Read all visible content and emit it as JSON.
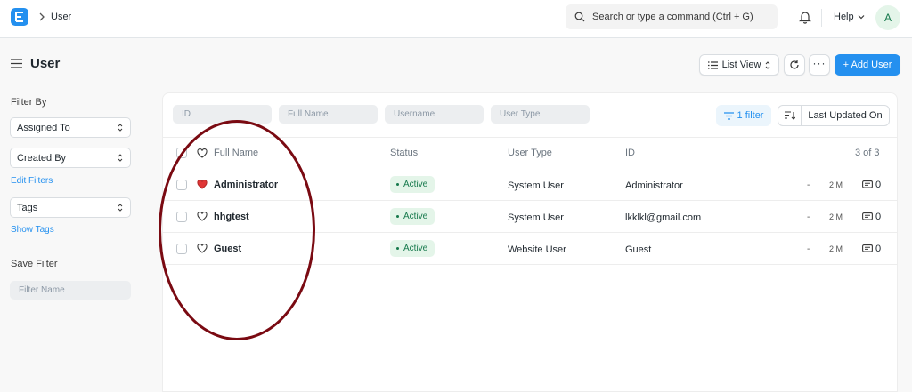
{
  "navbar": {
    "breadcrumb": "User",
    "search_placeholder": "Search or type a command (Ctrl + G)",
    "help_label": "Help",
    "avatar_initial": "A"
  },
  "page": {
    "title": "User",
    "list_view_label": "List View",
    "add_button_label": "+ Add User"
  },
  "sidebar": {
    "filter_by_label": "Filter By",
    "assigned_to": "Assigned To",
    "created_by": "Created By",
    "edit_filters": "Edit Filters",
    "tags": "Tags",
    "show_tags": "Show Tags",
    "save_filter_label": "Save Filter",
    "filter_name_placeholder": "Filter Name"
  },
  "filters": {
    "id_placeholder": "ID",
    "full_name_placeholder": "Full Name",
    "username_placeholder": "Username",
    "user_type_placeholder": "User Type",
    "filter_count_label": "1 filter",
    "sort_label": "Last Updated On"
  },
  "table": {
    "columns": {
      "full_name": "Full Name",
      "status": "Status",
      "user_type": "User Type",
      "id": "ID",
      "count": "3 of 3"
    },
    "rows": [
      {
        "name": "Administrator",
        "liked": true,
        "status": "Active",
        "user_type": "System User",
        "id": "Administrator",
        "dash": "-",
        "modified": "2 M",
        "comments": "0"
      },
      {
        "name": "hhgtest",
        "liked": false,
        "status": "Active",
        "user_type": "System User",
        "id": "lkklkl@gmail.com",
        "dash": "-",
        "modified": "2 M",
        "comments": "0"
      },
      {
        "name": "Guest",
        "liked": false,
        "status": "Active",
        "user_type": "Website User",
        "id": "Guest",
        "dash": "-",
        "modified": "2 M",
        "comments": "0"
      }
    ]
  },
  "colors": {
    "accent": "#2490ef",
    "active_badge_bg": "#e4f5e9",
    "active_badge_text": "#16794c",
    "liked_heart": "#e03636",
    "annotation_ellipse": "#7a0a12"
  }
}
